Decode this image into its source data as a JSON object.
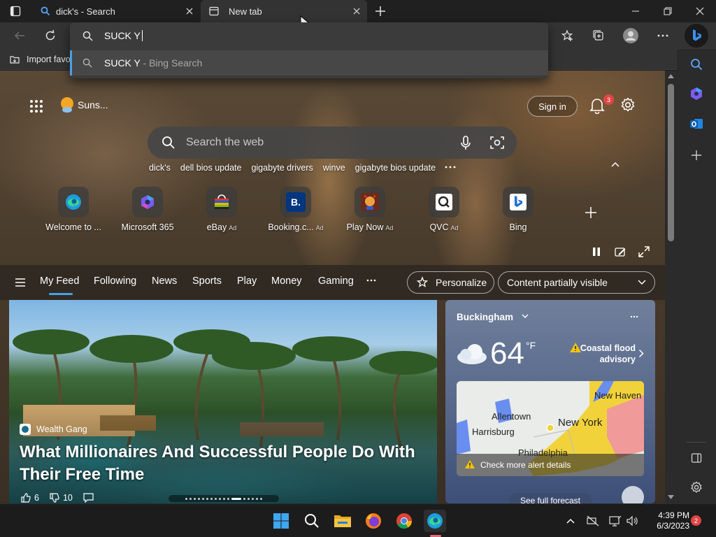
{
  "tabs": [
    {
      "label": "dick's - Search",
      "active": false
    },
    {
      "label": "New tab",
      "active": true
    }
  ],
  "omnibox": {
    "value": "SUCK Y",
    "suggestion_main": "SUCK Y",
    "suggestion_sub": " - Bing Search"
  },
  "favorites_bar": {
    "import_label": "Import favo"
  },
  "ntp": {
    "weather_short": "Suns...",
    "sign_in": "Sign in",
    "notification_count": "3",
    "search_placeholder": "Search the web",
    "trending": [
      "dick's",
      "dell bios update",
      "gigabyte drivers",
      "winve",
      "gigabyte bios update"
    ],
    "quick_links": [
      {
        "label": "Welcome to ...",
        "ad": ""
      },
      {
        "label": "Microsoft 365",
        "ad": ""
      },
      {
        "label": "eBay",
        "ad": "Ad"
      },
      {
        "label": "Booking.c...",
        "ad": "Ad"
      },
      {
        "label": "Play Now",
        "ad": "Ad"
      },
      {
        "label": "QVC",
        "ad": "Ad"
      },
      {
        "label": "Bing",
        "ad": ""
      }
    ],
    "booking_letter": "B."
  },
  "feed_nav": {
    "items": [
      "My Feed",
      "Following",
      "News",
      "Sports",
      "Play",
      "Money",
      "Gaming"
    ],
    "active": "My Feed",
    "personalize": "Personalize",
    "content_visibility": "Content partially visible"
  },
  "main_card": {
    "source": "Wealth Gang",
    "headline": "What Millionaires And Successful People Do With Their Free Time",
    "likes": "6",
    "dislikes": "10"
  },
  "weather": {
    "location": "Buckingham",
    "temperature": "64",
    "unit": "°F",
    "alert": "Coastal flood advisory",
    "map_labels": [
      "Allentown",
      "New York",
      "Harrisburg",
      "Philadelphia",
      "New Haven"
    ],
    "alert_details": "Check more alert details",
    "forecast_button": "See full forecast"
  },
  "taskbar": {
    "time": "4:39 PM",
    "date": "6/3/2023",
    "notification_count": "2"
  },
  "colors": {
    "accent": "#4aa0e6",
    "badge_red": "#e04545",
    "warning_yellow": "#f2c400"
  }
}
